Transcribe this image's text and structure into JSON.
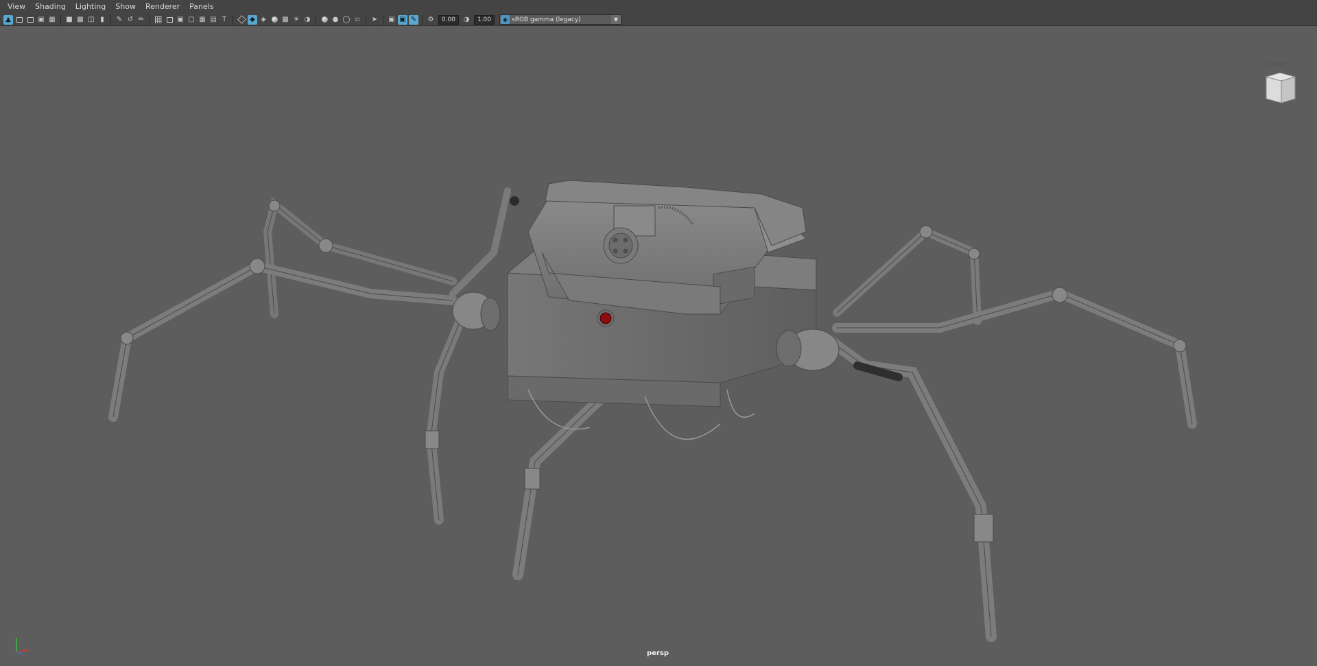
{
  "menu": {
    "items": [
      {
        "label": "View"
      },
      {
        "label": "Shading"
      },
      {
        "label": "Lighting"
      },
      {
        "label": "Show"
      },
      {
        "label": "Renderer"
      },
      {
        "label": "Panels"
      }
    ]
  },
  "toolbar": {
    "exposure": "0.00",
    "gamma": "1.00",
    "color_space": "sRGB gamma (legacy)"
  },
  "viewport": {
    "camera_label": "persp",
    "viewcube_face": "FRONT"
  },
  "colors": {
    "viewport_bg": "#5d5d5d",
    "toolbar_bg": "#444444",
    "active_accent": "#5aa7cf",
    "axis_x": "#d23a3a",
    "axis_y": "#3ac23a",
    "axis_z": "#3a6ed2",
    "sensor_red": "#8b0d0d"
  }
}
